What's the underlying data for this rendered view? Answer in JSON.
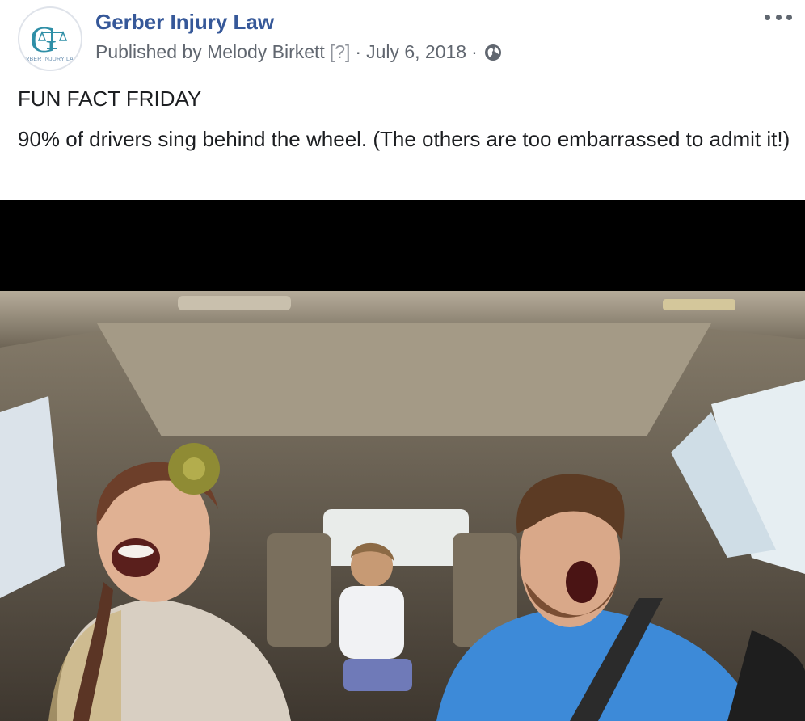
{
  "post": {
    "page_name": "Gerber Injury Law",
    "published_by": "Published by Melody Birkett",
    "unknown_marker": "[?]",
    "separator": "·",
    "date": "July 6, 2018",
    "privacy_icon": "globe-icon",
    "more_icon": "more-options-icon",
    "avatar": {
      "logo_letter": "G",
      "logo_caption": "ERBER INJURY LAW",
      "brand_color": "#2f8fa7"
    },
    "heading": "FUN FACT FRIDAY",
    "fact": "90% of drivers sing behind the wheel. (The others are too embarrassed to admit it!)"
  },
  "colors": {
    "link": "#365899",
    "meta": "#616770",
    "text": "#1c1e21"
  }
}
